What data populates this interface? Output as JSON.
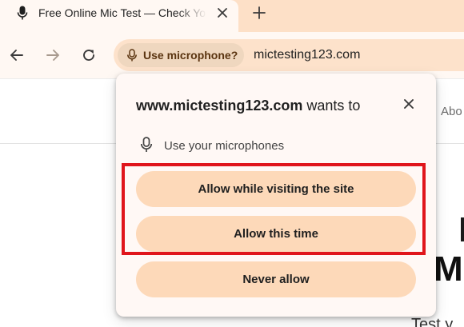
{
  "browser": {
    "tab": {
      "title": "Free Online Mic Test — Check Your Microphone",
      "favicon": "microphone-icon"
    },
    "toolbar": {
      "back_icon": "arrow-left-icon",
      "forward_icon": "arrow-right-icon",
      "reload_icon": "reload-icon",
      "permission_chip": {
        "icon": "microphone-icon",
        "label": "Use microphone?"
      },
      "url": "mictesting123.com"
    }
  },
  "page": {
    "nav_about": "Abo",
    "heading": "Mi",
    "subheading": "Test y"
  },
  "permission_popup": {
    "site": "www.mictesting123.com",
    "wants_to": " wants to",
    "close_icon": "close-icon",
    "permission": {
      "icon": "microphone-icon",
      "label": "Use your microphones"
    },
    "buttons": {
      "allow_while_visiting": "Allow while visiting the site",
      "allow_this_time": "Allow this time",
      "never_allow": "Never allow"
    },
    "highlight_color": "#e0151b"
  },
  "colors": {
    "tabstrip": "#fde0c7",
    "toolbar": "#fff8f3",
    "omnibox": "#fde2cb",
    "chip": "#efd7bf",
    "button": "#fdd9b9",
    "popup": "#fff8f5"
  }
}
